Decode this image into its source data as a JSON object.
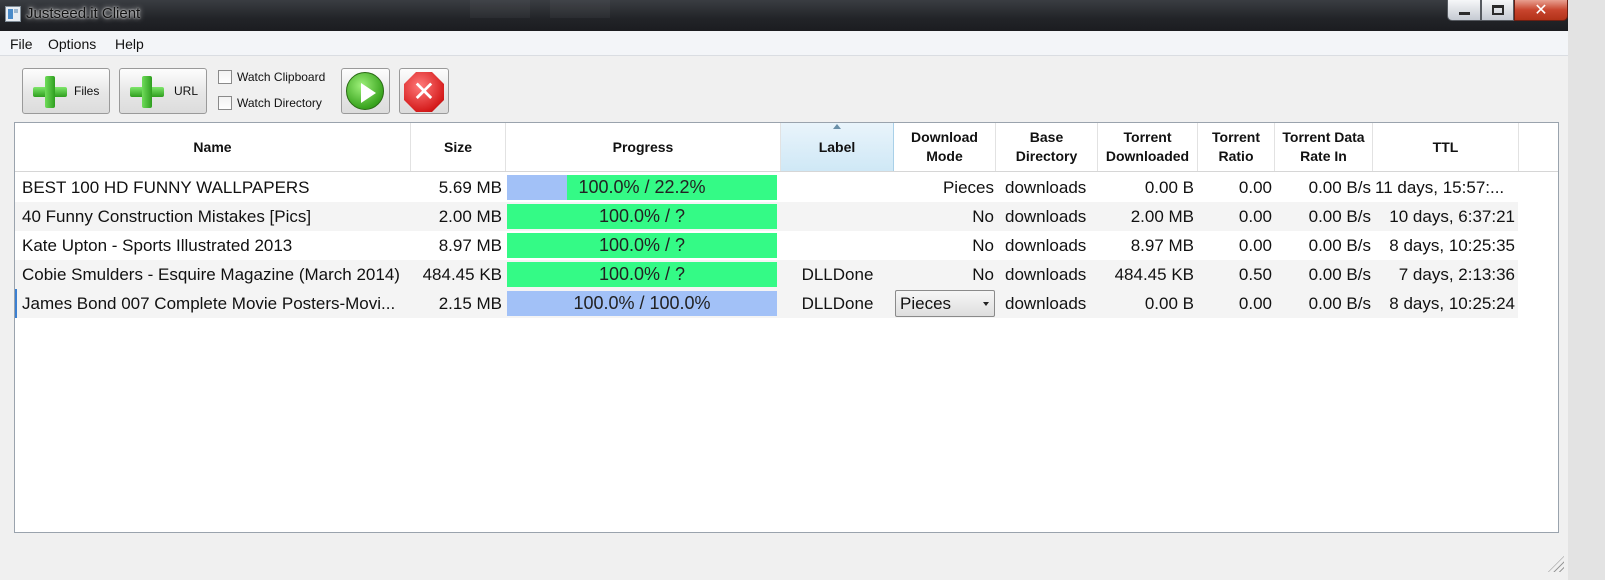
{
  "window": {
    "title": "Justseed.it Client",
    "close_glyph": "✕"
  },
  "menu": [
    "File",
    "Options",
    "Help"
  ],
  "toolbar": {
    "add_files_label": "Files",
    "add_url_label": "URL",
    "watch_clipboard_label": "Watch Clipboard",
    "watch_clipboard_checked": false,
    "watch_directory_label": "Watch Directory",
    "watch_directory_checked": false,
    "start_icon": "play-icon",
    "stop_icon": "stop-icon",
    "stop_glyph": "✕"
  },
  "table": {
    "sorted_column": "Label",
    "columns": [
      "Name",
      "Size",
      "Progress",
      "Label",
      "Download Mode",
      "Base Directory",
      "Torrent Downloaded",
      "Torrent Ratio",
      "Torrent Data Rate In",
      "TTL"
    ],
    "rows": [
      {
        "name": "BEST  100 HD  FUNNY WALLPAPERS",
        "size": "5.69 MB",
        "progress_text": "100.0% / 22.2%",
        "progress": 0.222,
        "label": "",
        "mode": "Pieces",
        "base_dir": "downloads",
        "downloaded": "0.00 B",
        "ratio": "0.00",
        "rate_in": "0.00 B/s",
        "ttl": "11 days, 15:57:..."
      },
      {
        "name": "40 Funny Construction Mistakes [Pics]",
        "size": "2.00 MB",
        "progress_text": "100.0% / ?",
        "progress": null,
        "label": "",
        "mode": "No",
        "base_dir": "downloads",
        "downloaded": "2.00 MB",
        "ratio": "0.00",
        "rate_in": "0.00 B/s",
        "ttl": "10 days, 6:37:21"
      },
      {
        "name": "Kate Upton - Sports Illustrated 2013",
        "size": "8.97 MB",
        "progress_text": "100.0% / ?",
        "progress": null,
        "label": "",
        "mode": "No",
        "base_dir": "downloads",
        "downloaded": "8.97 MB",
        "ratio": "0.00",
        "rate_in": "0.00 B/s",
        "ttl": "8 days, 10:25:35"
      },
      {
        "name": "Cobie Smulders - Esquire Magazine (March 2014)",
        "size": "484.45 KB",
        "progress_text": "100.0% / ?",
        "progress": null,
        "label": "DLLDone",
        "mode": "No",
        "base_dir": "downloads",
        "downloaded": "484.45 KB",
        "ratio": "0.50",
        "rate_in": "0.00 B/s",
        "ttl": "7 days, 2:13:36"
      },
      {
        "name": "James Bond 007 Complete Movie Posters-Movi...",
        "size": "2.15 MB",
        "progress_text": "100.0% / 100.0%",
        "progress": 1.0,
        "label": "DLLDone",
        "mode": "Pieces",
        "mode_is_dropdown": true,
        "base_dir": "downloads",
        "downloaded": "0.00 B",
        "ratio": "0.00",
        "rate_in": "0.00 B/s",
        "ttl": "8 days, 10:25:24"
      }
    ]
  },
  "colors": {
    "progress_green": "#34fa86",
    "progress_blue": "#a2c1f7",
    "selected_header": "#cfe8f6"
  }
}
